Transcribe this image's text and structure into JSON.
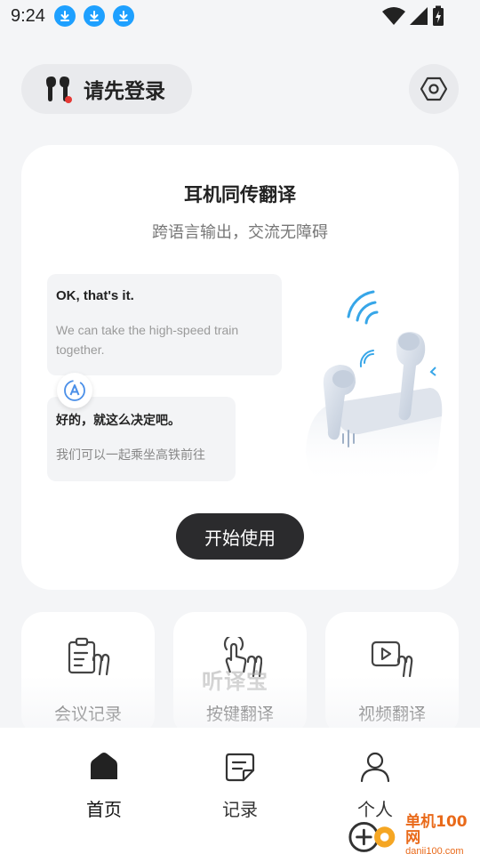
{
  "status_bar": {
    "time": "9:24",
    "icons": [
      "download-icon",
      "download-icon",
      "download-icon",
      "wifi-icon",
      "signal-icon",
      "battery-charging-icon"
    ]
  },
  "header": {
    "login_label": "请先登录",
    "login_icon": "earbuds-icon",
    "settings_icon": "settings-icon"
  },
  "hero_card": {
    "title": "耳机同传翻译",
    "subtitle": "跨语言输出，交流无障碍",
    "bubble_en": {
      "main": "OK, that's it.",
      "sub": "We can take the high-speed train together."
    },
    "bubble_zh": {
      "main": "好的，就这么决定吧。",
      "sub": "我们可以一起乘坐高铁前往"
    },
    "start_button": "开始使用"
  },
  "features": [
    {
      "label": "会议记录",
      "icon": "meeting-clipboard-icon"
    },
    {
      "label": "按键翻译",
      "icon": "press-key-icon",
      "watermark": "听译宝"
    },
    {
      "label": "视频翻译",
      "icon": "video-translate-icon"
    }
  ],
  "bottom_nav": [
    {
      "label": "首页",
      "icon": "home-icon",
      "active": true
    },
    {
      "label": "记录",
      "icon": "records-icon",
      "active": false
    },
    {
      "label": "个人",
      "icon": "person-icon",
      "active": false
    }
  ],
  "corner_logo": {
    "line1": "单机100网",
    "line2": "danji100.com"
  },
  "colors": {
    "background": "#f4f5f7",
    "card": "#ffffff",
    "primary_button": "#2b2b2d",
    "accent_blue": "#1ea0ff",
    "logo_orange": "#e96a1a"
  }
}
